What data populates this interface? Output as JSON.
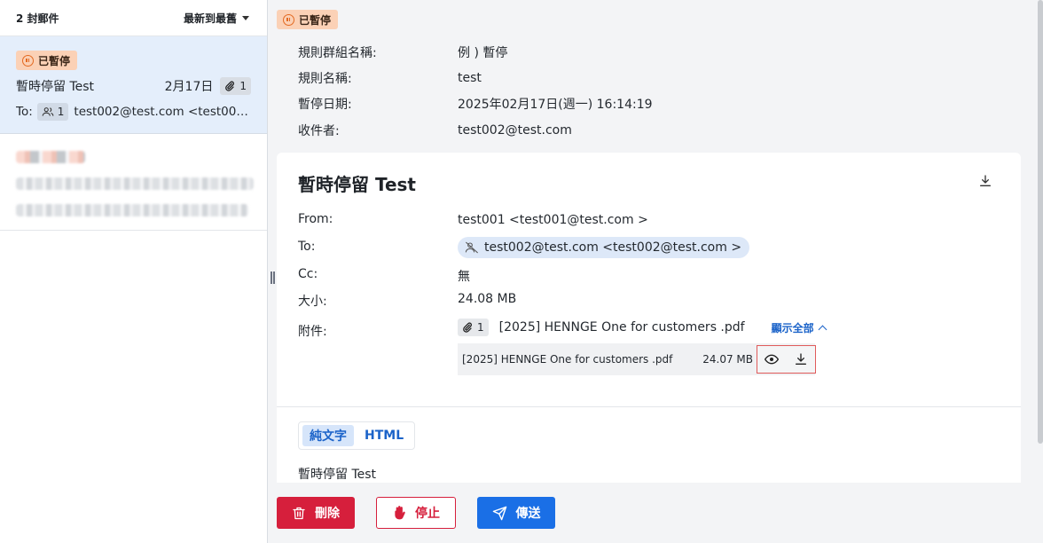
{
  "list": {
    "count_label": "2 封郵件",
    "sort_label": "最新到最舊",
    "selected": {
      "badge": "已暫停",
      "subject": "暫時停留 Test",
      "date": "2月17日",
      "attachments": "1",
      "to_label": "To:",
      "recipients": "1",
      "to": "test002@test.com <test002@…"
    }
  },
  "detail": {
    "badge": "已暫停",
    "meta": [
      {
        "key": "規則群組名稱:",
        "value": "例 ) 暫停"
      },
      {
        "key": "規則名稱:",
        "value": "test"
      },
      {
        "key": "暫停日期:",
        "value": "2025年02月17日(週一) 16:14:19"
      },
      {
        "key": "收件者:",
        "value": "test002@test.com"
      }
    ],
    "message": {
      "title": "暫時停留 Test",
      "from_label": "From:",
      "from": "test001 <test001@test.com >",
      "to_label": "To:",
      "to": "test002@test.com <test002@test.com >",
      "cc_label": "Cc:",
      "cc": "無",
      "size_label": "大小:",
      "size": "24.08 MB",
      "att_label": "附件:",
      "att_count": "1",
      "att_name": "[2025] HENNGE One for customers .pdf",
      "show_all": "顯示全部",
      "file_name": "[2025] HENNGE One for customers .pdf",
      "file_size": "24.07 MB",
      "tabs": [
        "純文字",
        "HTML"
      ],
      "body": "暫時停留 Test"
    }
  },
  "actions": {
    "delete": "刪除",
    "stop": "停止",
    "send": "傳送"
  },
  "colors": {
    "danger": "#d61f3c",
    "primary": "#1a6fe6",
    "paused_badge": "#fbd1b6"
  }
}
